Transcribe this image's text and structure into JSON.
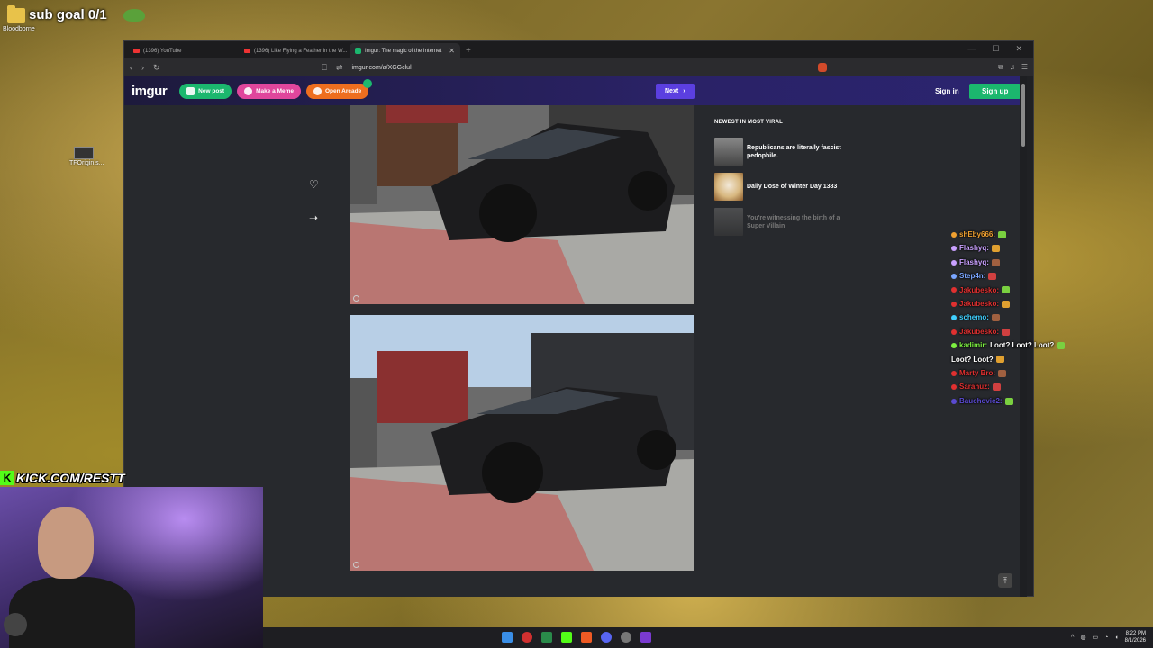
{
  "overlay": {
    "sub_goal": "sub goal 0/1",
    "desktop_icon_label": "Bloodborne",
    "desktop_icon2_label": "TFOrigin.s...",
    "kick_url": "KICK.COM/RESTT"
  },
  "browser": {
    "tabs": [
      {
        "label": "(1396) YouTube",
        "active": false
      },
      {
        "label": "(1396) Like Flying a Feather in the W...",
        "active": false
      },
      {
        "label": "Imgur: The magic of the Internet",
        "active": true
      }
    ],
    "url": "imgur.com/a/XGGclul"
  },
  "imgur": {
    "logo": "imgur",
    "new_post": "New post",
    "make_meme": "Make a Meme",
    "open_arcade": "Open Arcade",
    "next": "Next",
    "sign_in": "Sign in",
    "sign_up": "Sign up",
    "viral_heading": "NEWEST IN MOST VIRAL",
    "viral_items": [
      {
        "title": "Republicans are literally fascist pedophile."
      },
      {
        "title": "Daily Dose of Winter Day 1383"
      },
      {
        "title": "You're witnessing the birth of a Super Villain"
      }
    ]
  },
  "chat": [
    {
      "user": "shEby666:",
      "color": "#f0a030",
      "msg": ""
    },
    {
      "user": "Flashyq:",
      "color": "#c9a0ff",
      "msg": ""
    },
    {
      "user": "Flashyq:",
      "color": "#c9a0ff",
      "msg": ""
    },
    {
      "user": "Step4n:",
      "color": "#7aa6ff",
      "msg": ""
    },
    {
      "user": "Jakubesko:",
      "color": "#e03030",
      "msg": ""
    },
    {
      "user": "Jakubesko:",
      "color": "#e03030",
      "msg": ""
    },
    {
      "user": "schemo:",
      "color": "#40d0ff",
      "msg": ""
    },
    {
      "user": "Jakubesko:",
      "color": "#e03030",
      "msg": ""
    },
    {
      "user": "kadimir:",
      "color": "#7cf040",
      "msg": "Loot? Loot? Loot?"
    },
    {
      "user": "",
      "color": "#ffffff",
      "msg": "Loot? Loot?"
    },
    {
      "user": "Marty Bro:",
      "color": "#e03030",
      "msg": ""
    },
    {
      "user": "Sarahuz:",
      "color": "#e03030",
      "msg": ""
    },
    {
      "user": "Bauchovic2:",
      "color": "#5a4ad0",
      "msg": ""
    }
  ],
  "taskbar": {
    "time": "8:22 PM",
    "date": "8/1/2026"
  }
}
